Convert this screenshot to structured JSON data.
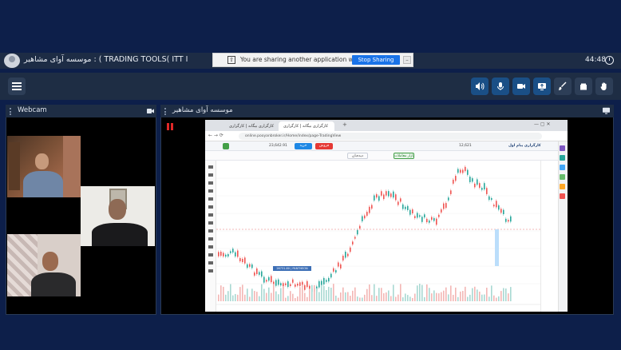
{
  "window": {
    "title": "موسسه آوای مشاهیر : ( TRADING TOOLS( ITT I",
    "clock": "44:48"
  },
  "share_banner": {
    "message": "You are sharing another application window.",
    "stop_label": "Stop Sharing"
  },
  "panels": {
    "webcam_label": "Webcam",
    "screen_label": "موسسه آوای مشاهیر"
  },
  "toolbar": {
    "icons": [
      "speaker-icon",
      "microphone-icon",
      "camera-icon",
      "screen-share-icon",
      "brush-icon",
      "file-icon",
      "hand-icon"
    ]
  },
  "browser": {
    "tab1": "کارگزاری بیگانه | کارگزاری",
    "tab2": "کارگزاری بیگانه | کارگزاری",
    "url": "online.pooyanbroker.ir/Home/index/page-TradingView",
    "brand": "کارگزاری پیام اول",
    "symbol_price": "12,621",
    "buy_label": "خرید",
    "sell_label": "فروش",
    "index_value": "23,642.91",
    "filter_a": "بازار معاملات",
    "filter_b": "دیده‌بان",
    "price_tag": "26731.80 | PANTHEON"
  },
  "colors": {
    "background": "#0d1f4a",
    "bar": "#1e2d44",
    "accent_blue": "#1a4f86",
    "stop_sharing": "#1a73e8",
    "candle_up": "#26a69a",
    "candle_down": "#ef5350"
  }
}
